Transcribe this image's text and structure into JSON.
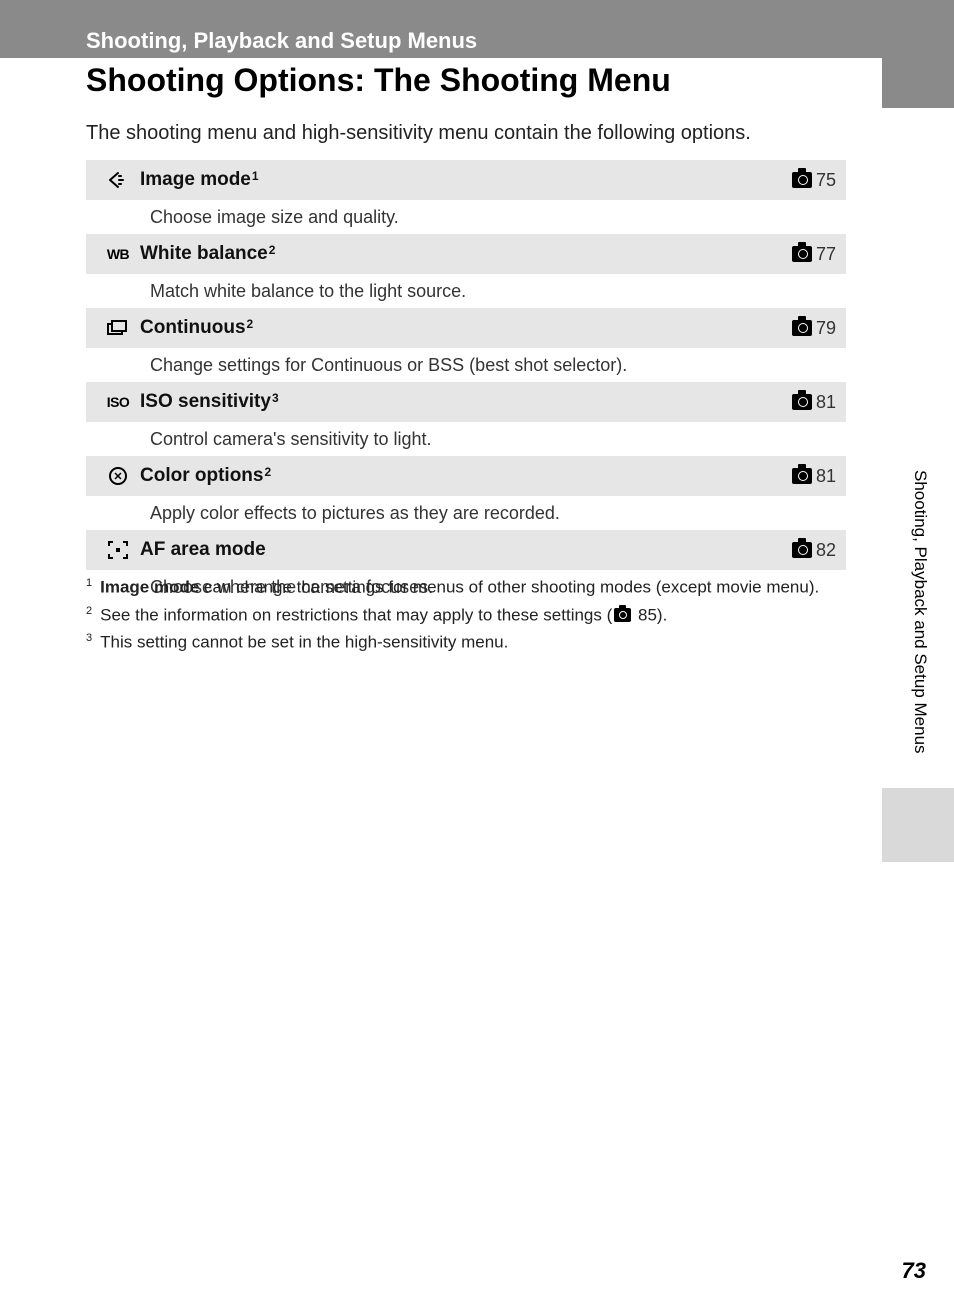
{
  "breadcrumb": "Shooting, Playback and Setup Menus",
  "section_title": "Shooting Options: The Shooting Menu",
  "intro": "The shooting menu and high-sensitivity menu contain the following options.",
  "items": [
    {
      "label": "Image mode",
      "sup": "1",
      "page": "75",
      "desc": "Choose image size and quality."
    },
    {
      "label": "White balance",
      "sup": "2",
      "page": "77",
      "desc": "Match white balance to the light source."
    },
    {
      "label": "Continuous",
      "sup": "2",
      "page": "79",
      "desc": "Change settings for Continuous or BSS (best shot selector)."
    },
    {
      "label": "ISO sensitivity",
      "sup": "3",
      "page": "81",
      "desc": "Control camera's sensitivity to light."
    },
    {
      "label": "Color options",
      "sup": "2",
      "page": "81",
      "desc": "Apply color effects to pictures as they are recorded."
    },
    {
      "label": "AF area mode",
      "sup": "",
      "page": "82",
      "desc": "Choose where the camera focuses."
    }
  ],
  "footnotes": {
    "f1_bold": "Image mode",
    "f1_rest": " can change the settings for menus of other shooting modes (except movie menu).",
    "f2_a": "See the information on restrictions that may apply to these settings (",
    "f2_b": " 85).",
    "f3": "This setting cannot be set in the high-sensitivity menu."
  },
  "side_tab": "Shooting, Playback and Setup Menus",
  "page_number": "73"
}
